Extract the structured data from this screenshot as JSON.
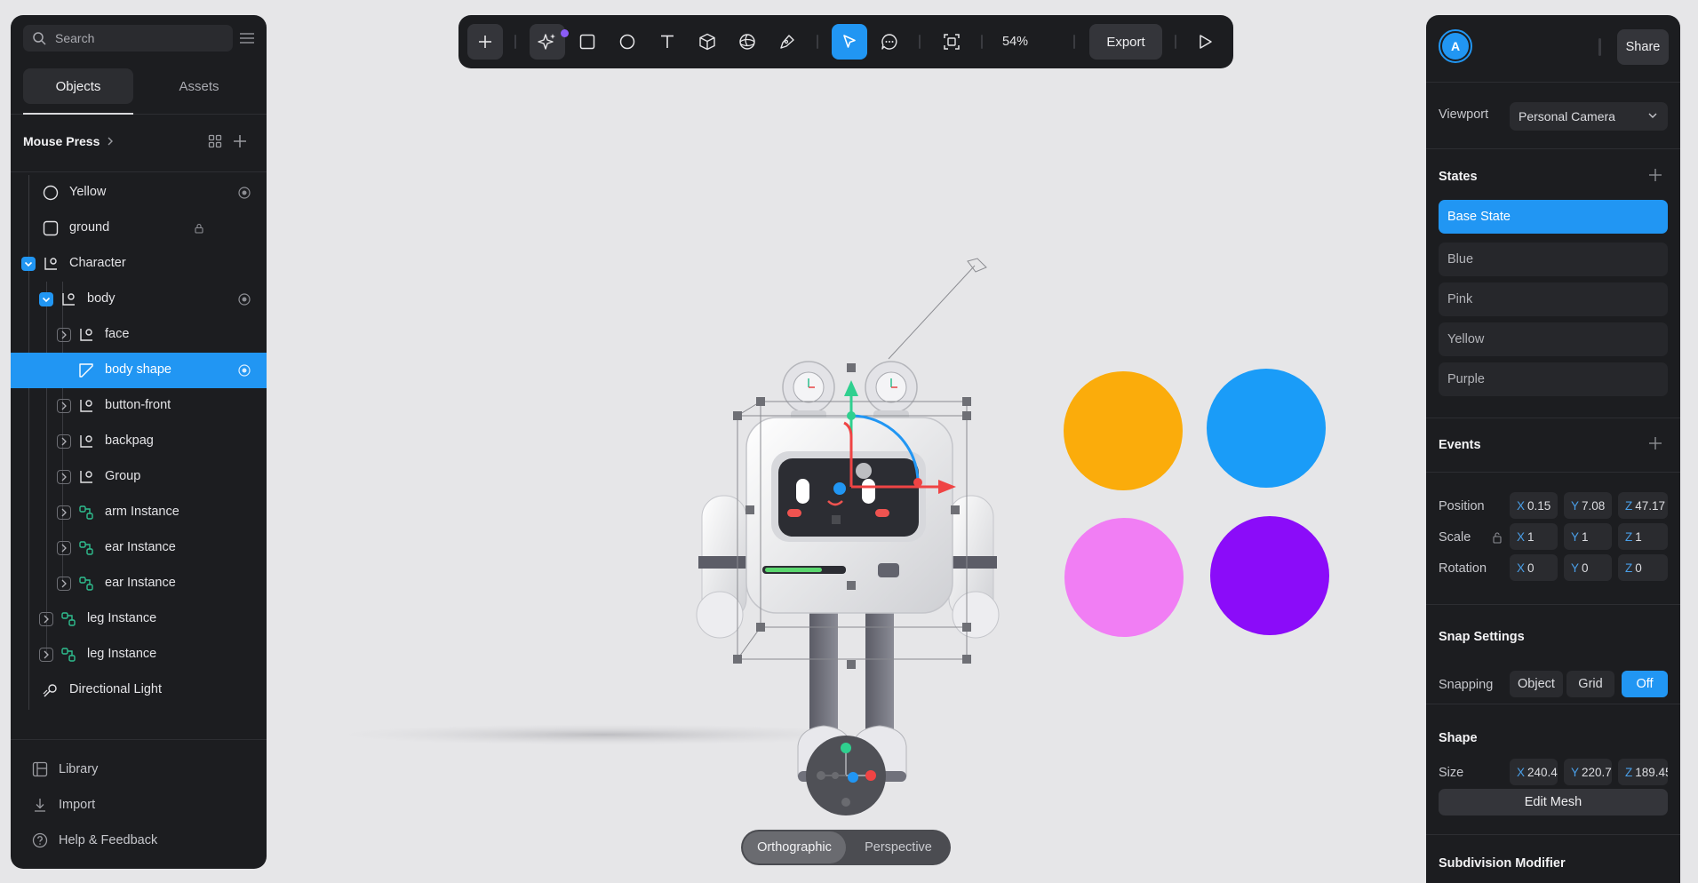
{
  "left_panel": {
    "search_placeholder": "Search",
    "tabs": [
      "Objects",
      "Assets"
    ],
    "breadcrumb": "Mouse Press",
    "tree": [
      {
        "label": "Yellow"
      },
      {
        "label": "ground"
      },
      {
        "label": "Character"
      },
      {
        "label": "body"
      },
      {
        "label": "face"
      },
      {
        "label": "body shape"
      },
      {
        "label": "button-front"
      },
      {
        "label": "backpag"
      },
      {
        "label": "Group"
      },
      {
        "label": "arm Instance"
      },
      {
        "label": "ear Instance"
      },
      {
        "label": "ear Instance"
      },
      {
        "label": "leg Instance"
      },
      {
        "label": "leg Instance"
      },
      {
        "label": "Directional Light"
      }
    ],
    "footer": [
      "Library",
      "Import",
      "Help & Feedback"
    ]
  },
  "toolbar": {
    "zoom": "54%",
    "export_label": "Export"
  },
  "canvas": {
    "view_modes": [
      "Orthographic",
      "Perspective"
    ],
    "active_view": "Orthographic",
    "color_swatches": [
      "#fbac0b",
      "#1a9cf8",
      "#f17ef4",
      "#8b0cf9"
    ]
  },
  "right_panel": {
    "avatar_initial": "A",
    "share_label": "Share",
    "viewport_label": "Viewport",
    "viewport_value": "Personal Camera",
    "states_heading": "States",
    "states": [
      "Base State",
      "Blue",
      "Pink",
      "Yellow",
      "Purple"
    ],
    "active_state": "Base State",
    "events_heading": "Events",
    "transform": {
      "position_label": "Position",
      "position": {
        "x": "0.15",
        "y": "7.08",
        "z": "47.17"
      },
      "scale_label": "Scale",
      "scale": {
        "x": "1",
        "y": "1",
        "z": "1"
      },
      "rotation_label": "Rotation",
      "rotation": {
        "x": "0",
        "y": "0",
        "z": "0"
      }
    },
    "snap_heading": "Snap Settings",
    "snapping_label": "Snapping",
    "snap_options": [
      "Object",
      "Grid",
      "Off"
    ],
    "snap_active": "Off",
    "shape_heading": "Shape",
    "size_label": "Size",
    "size": {
      "x": "240.4",
      "y": "220.7",
      "z": "189.45"
    },
    "edit_mesh_label": "Edit Mesh",
    "subdivision_heading": "Subdivision Modifier"
  }
}
